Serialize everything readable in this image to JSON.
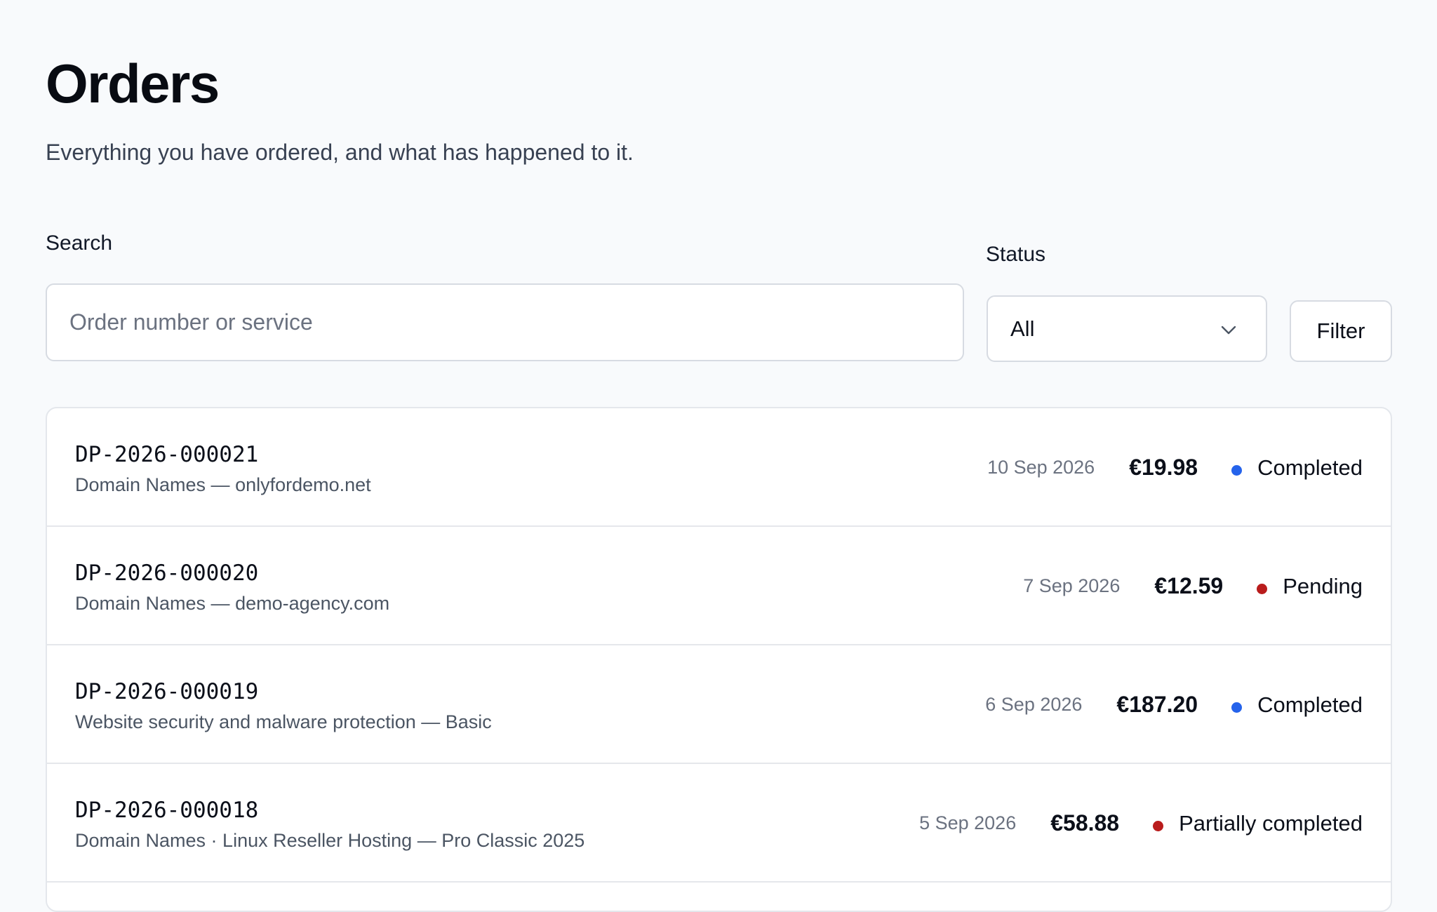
{
  "header": {
    "title": "Orders",
    "subtitle": "Everything you have ordered, and what has happened to it."
  },
  "filters": {
    "search_label": "Search",
    "search_placeholder": "Order number or service",
    "search_value": "",
    "status_label": "Status",
    "status_selected": "All",
    "filter_button": "Filter"
  },
  "colors": {
    "completed": "#2563eb",
    "pending": "#b91c1c",
    "partially_completed": "#b91c1c"
  },
  "orders": [
    {
      "id": "DP-2026-000021",
      "description": "Domain Names — onlyfordemo.net",
      "date": "10 Sep 2026",
      "amount": "€19.98",
      "status": "Completed",
      "status_color": "#2563eb"
    },
    {
      "id": "DP-2026-000020",
      "description": "Domain Names — demo-agency.com",
      "date": "7 Sep 2026",
      "amount": "€12.59",
      "status": "Pending",
      "status_color": "#b91c1c"
    },
    {
      "id": "DP-2026-000019",
      "description": "Website security and malware protection — Basic",
      "date": "6 Sep 2026",
      "amount": "€187.20",
      "status": "Completed",
      "status_color": "#2563eb"
    },
    {
      "id": "DP-2026-000018",
      "description": "Domain Names · Linux Reseller Hosting — Pro Classic 2025",
      "date": "5 Sep 2026",
      "amount": "€58.88",
      "status": "Partially completed",
      "status_color": "#b91c1c"
    }
  ]
}
